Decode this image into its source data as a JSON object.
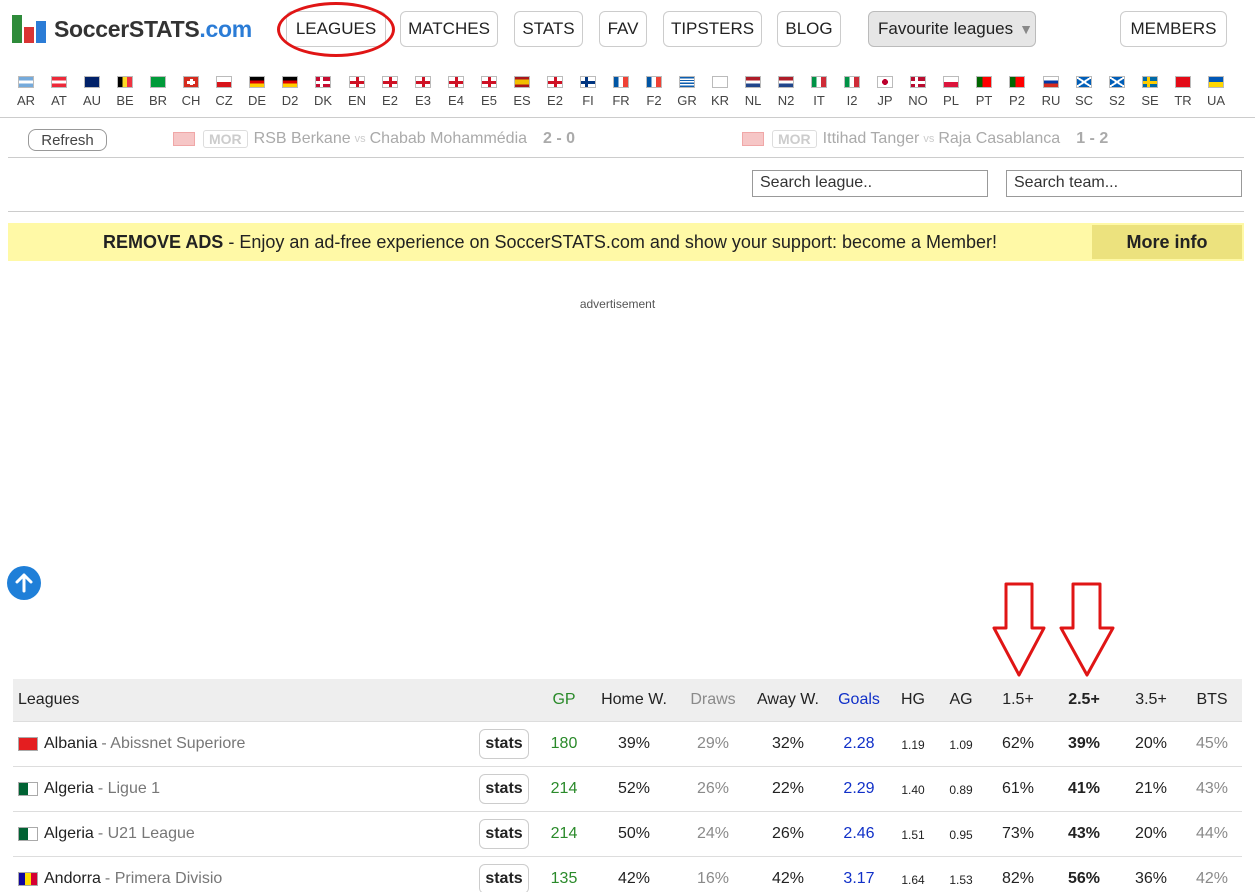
{
  "logo": {
    "text_main": "SoccerSTATS",
    "text_domain": ".com"
  },
  "nav": {
    "leagues": "LEAGUES",
    "matches": "MATCHES",
    "stats": "STATS",
    "fav": "FAV",
    "tipsters": "TIPSTERS",
    "blog": "BLOG",
    "favourite_leagues": "Favourite leagues",
    "members": "MEMBERS"
  },
  "flags": [
    "AR",
    "AT",
    "AU",
    "BE",
    "BR",
    "CH",
    "CZ",
    "DE",
    "D2",
    "DK",
    "EN",
    "E2",
    "E3",
    "E4",
    "E5",
    "ES",
    "E2",
    "FI",
    "FR",
    "F2",
    "GR",
    "KR",
    "NL",
    "N2",
    "IT",
    "I2",
    "JP",
    "NO",
    "PL",
    "PT",
    "P2",
    "RU",
    "SC",
    "S2",
    "SE",
    "TR",
    "UA"
  ],
  "live": {
    "refresh": "Refresh",
    "matches": [
      {
        "tag": "MOR",
        "home": "RSB Berkane",
        "vs": "vs",
        "away": "Chabab Mohammédia",
        "score": "2 - 0"
      },
      {
        "tag": "MOR",
        "home": "Ittihad Tanger",
        "vs": "vs",
        "away": "Raja Casablanca",
        "score": "1 - 2"
      }
    ]
  },
  "search": {
    "league_placeholder": "Search league..",
    "team_placeholder": "Search team..."
  },
  "banner": {
    "bold": "REMOVE ADS",
    "text": "- Enjoy an ad-free experience on SoccerSTATS.com and show your support: become a Member!",
    "more_info": "More info"
  },
  "ad_label": "advertisement",
  "colors": {
    "accent": "#2b7cd6",
    "highlight_red": "#e01515",
    "banner_bg": "#fff9a6",
    "gp_green": "#2a8a2a",
    "goals_blue": "#1030c8"
  },
  "table": {
    "headers": {
      "leagues": "Leagues",
      "gp": "GP",
      "home_w": "Home W.",
      "draws": "Draws",
      "away_w": "Away W.",
      "goals": "Goals",
      "hg": "HG",
      "ag": "AG",
      "o15": "1.5+",
      "o25": "2.5+",
      "o35": "3.5+",
      "bts": "BTS"
    },
    "stats_label": "stats",
    "rows": [
      {
        "country": "Albania",
        "league": "- Abissnet Superiore",
        "gp": "180",
        "home_w": "39%",
        "draws": "29%",
        "away_w": "32%",
        "goals": "2.28",
        "hg": "1.19",
        "ag": "1.09",
        "o15": "62%",
        "o25": "39%",
        "o35": "20%",
        "bts": "45%"
      },
      {
        "country": "Algeria",
        "league": "- Ligue 1",
        "gp": "214",
        "home_w": "52%",
        "draws": "26%",
        "away_w": "22%",
        "goals": "2.29",
        "hg": "1.40",
        "ag": "0.89",
        "o15": "61%",
        "o25": "41%",
        "o35": "21%",
        "bts": "43%"
      },
      {
        "country": "Algeria",
        "league": "- U21 League",
        "gp": "214",
        "home_w": "50%",
        "draws": "24%",
        "away_w": "26%",
        "goals": "2.46",
        "hg": "1.51",
        "ag": "0.95",
        "o15": "73%",
        "o25": "43%",
        "o35": "20%",
        "bts": "44%"
      },
      {
        "country": "Andorra",
        "league": "- Primera Divisio",
        "gp": "135",
        "home_w": "42%",
        "draws": "16%",
        "away_w": "42%",
        "goals": "3.17",
        "hg": "1.64",
        "ag": "1.53",
        "o15": "82%",
        "o25": "56%",
        "o35": "36%",
        "bts": "42%"
      }
    ]
  }
}
